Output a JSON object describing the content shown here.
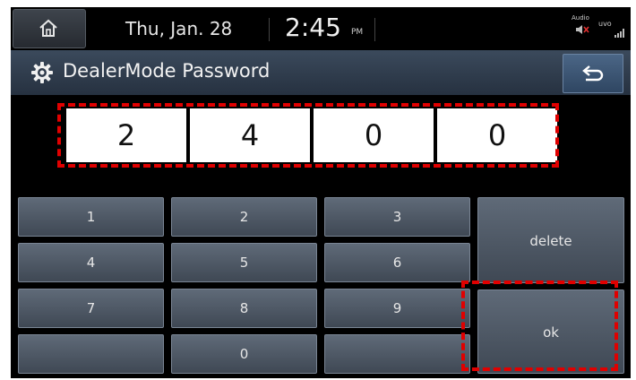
{
  "status": {
    "date": "Thu, Jan. 28",
    "time": "2:45",
    "ampm": "PM",
    "audio_label": "Audio",
    "uvo_label": "uvo"
  },
  "title_bar": {
    "title": "DealerMode Password"
  },
  "password": {
    "digits": [
      "2",
      "4",
      "0",
      "0"
    ]
  },
  "keypad": {
    "keys": [
      "1",
      "2",
      "3",
      "4",
      "5",
      "6",
      "7",
      "8",
      "9",
      "",
      "0",
      ""
    ],
    "delete_label": "delete",
    "ok_label": "ok"
  },
  "colors": {
    "highlight": "#e00000",
    "titlebar": "#2f3b4b",
    "key": "#4d5664"
  },
  "icons": [
    "home-icon",
    "gear-icon",
    "back-arrow-icon",
    "audio-muted-icon",
    "signal-icon"
  ]
}
